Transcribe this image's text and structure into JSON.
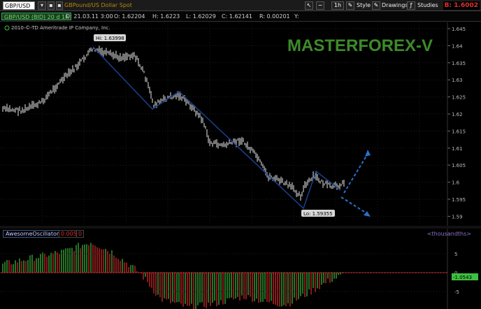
{
  "toolbar": {
    "symbol_value": "GBP/USD",
    "description": "GBPound/US Dollar Spot",
    "timeframe": "1h",
    "style_label": "Style",
    "drawings_label": "Drawings",
    "studies_label": "Studies",
    "bid_label": "B: 1.6002"
  },
  "quote": {
    "symbol_line": "GBP/USD (BID) 20 d 1h",
    "date": "D: 21.03.11 3:00",
    "open": "O: 1.62204",
    "high": "H: 1.6223",
    "low": "L: 1.62029",
    "close": "C: 1.62141",
    "range": "R: 0.00201",
    "y": "Y:"
  },
  "chart": {
    "copyright": "2010-©-TD Ameritrade IP Company, Inc.",
    "watermark": "MASTERFOREX-V",
    "hi_label": "Hi: 1.63998",
    "lo_label": "Lo: 1.59355",
    "price_ticks": [
      "1.645",
      "1.64",
      "1.635",
      "1.63",
      "1.625",
      "1.62",
      "1.615",
      "1.61",
      "1.605",
      "1.6",
      "1.595",
      "1.59"
    ]
  },
  "indicator": {
    "name": "AwesomeOscillator",
    "value": "0.0056",
    "zero": "0",
    "units": "<thousandths>",
    "ticks": [
      "5",
      "0",
      "-5"
    ],
    "current": "-1.0543"
  },
  "colors": {
    "price_bars": "#e8e8e8",
    "trend_lines": "#1c3f8c",
    "projection": "#2c70c8",
    "watermark": "#3d8a2a",
    "osc_up": "#3fbf3f",
    "osc_down": "#e03030"
  }
}
